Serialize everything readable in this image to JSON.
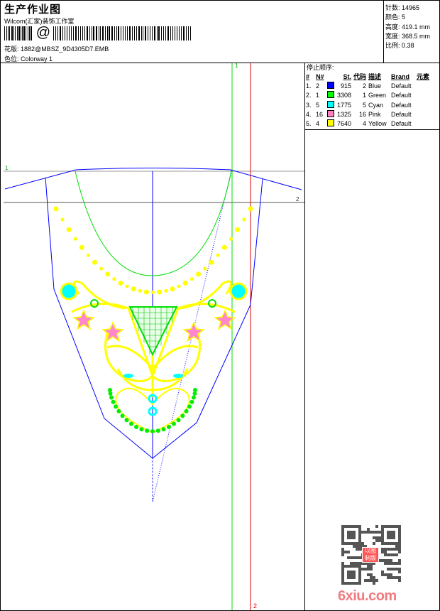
{
  "header": {
    "title": "生产作业图",
    "company": "Wilcom(汇家)装饰工作室",
    "barcode_symbol": "@",
    "design_file_label": "花版:",
    "design_file": "1882@MBSZ_9D4305D7.EMB",
    "colorway_label": "色位:",
    "colorway": "Colorway 1"
  },
  "info": [
    {
      "label": "针数:",
      "value": "14965"
    },
    {
      "label": "颜色:",
      "value": "5"
    },
    {
      "label": "高度:",
      "value": "419.1 mm"
    },
    {
      "label": "宽度:",
      "value": "368.5 mm"
    },
    {
      "label": "比例:",
      "value": "0.38"
    }
  ],
  "stop_sequence": {
    "title": "停止顺序:",
    "headers": {
      "num": "#",
      "needle": "N#",
      "stitches": "St.",
      "code": "代码",
      "desc": "描述",
      "brand": "Brand",
      "element": "元素"
    },
    "rows": [
      {
        "num": "1.",
        "needle": "2",
        "color": "#0000ff",
        "stitches": "915",
        "code": "2",
        "desc": "Blue",
        "brand": "Default"
      },
      {
        "num": "2.",
        "needle": "1",
        "color": "#00ff00",
        "stitches": "3308",
        "code": "1",
        "desc": "Green",
        "brand": "Default"
      },
      {
        "num": "3.",
        "needle": "5",
        "color": "#00ffff",
        "stitches": "1775",
        "code": "5",
        "desc": "Cyan",
        "brand": "Default"
      },
      {
        "num": "4.",
        "needle": "16",
        "color": "#ff80c0",
        "stitches": "1325",
        "code": "16",
        "desc": "Pink",
        "brand": "Default"
      },
      {
        "num": "5.",
        "needle": "4",
        "color": "#ffff00",
        "stitches": "7640",
        "code": "4",
        "desc": "Yellow",
        "brand": "Default"
      }
    ]
  },
  "guides": {
    "h1": "1",
    "h2": "2",
    "v1": "1",
    "v2": "2"
  },
  "watermark": "6xiu.com",
  "stamp": "以图制版"
}
